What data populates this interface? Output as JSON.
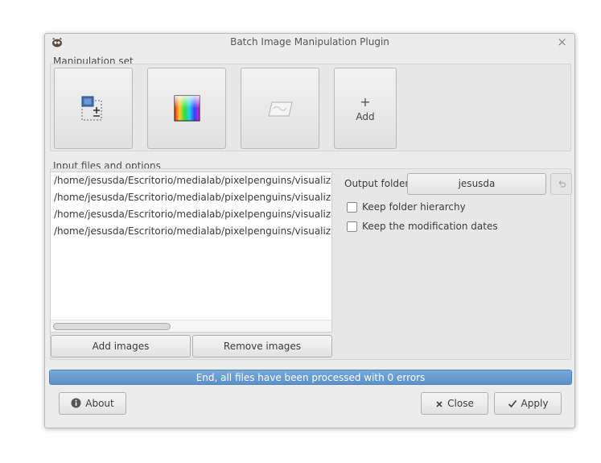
{
  "window": {
    "title": "Batch Image Manipulation Plugin",
    "close_glyph": "×"
  },
  "manipulation_set": {
    "label": "Manipulation set",
    "buttons": [
      {
        "icon": "resize-icon"
      },
      {
        "icon": "color-correction-icon"
      },
      {
        "icon": "perspective-icon"
      }
    ],
    "add_button": {
      "plus": "+",
      "label": "Add"
    }
  },
  "input_files": {
    "label": "Input files and options",
    "files": [
      "/home/jesusda/Escritorio/medialab/pixelpenguins/visualizar-t",
      "/home/jesusda/Escritorio/medialab/pixelpenguins/visualizar-t",
      "/home/jesusda/Escritorio/medialab/pixelpenguins/visualizar-t",
      "/home/jesusda/Escritorio/medialab/pixelpenguins/visualizar-t"
    ],
    "add_images_label": "Add images",
    "remove_images_label": "Remove images"
  },
  "output": {
    "folder_label": "Output folder",
    "folder_value": "jesusda",
    "keep_hierarchy_label": "Keep folder hierarchy",
    "keep_hierarchy_checked": false,
    "keep_dates_label": "Keep the modification dates",
    "keep_dates_checked": false
  },
  "status": {
    "message": "End, all files have been processed with 0 errors",
    "progress": 1.0
  },
  "footer": {
    "about_label": "About",
    "close_label": "Close",
    "apply_label": "Apply"
  },
  "colors": {
    "accent": "#5b91ca",
    "progress_border": "#4e82b9"
  }
}
